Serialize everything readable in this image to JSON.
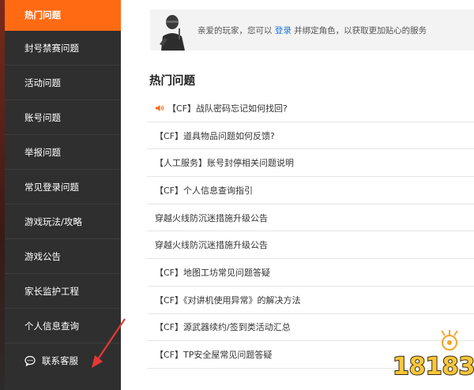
{
  "sidebar": {
    "items": [
      {
        "label": "热门问题",
        "active": true
      },
      {
        "label": "封号禁赛问题"
      },
      {
        "label": "活动问题"
      },
      {
        "label": "账号问题"
      },
      {
        "label": "举报问题"
      },
      {
        "label": "常见登录问题"
      },
      {
        "label": "游戏玩法/攻略"
      },
      {
        "label": "游戏公告"
      },
      {
        "label": "家长监护工程"
      },
      {
        "label": "个人信息查询"
      }
    ],
    "contact": {
      "label": "联系客服",
      "icon": "chat-bubble-icon"
    }
  },
  "notice": {
    "prefix": "亲爱的玩家，您可以 ",
    "login_link": "登录",
    "suffix": " 并绑定角色，以获取更加贴心的服务"
  },
  "main": {
    "section_title": "热门问题",
    "questions": [
      {
        "text": "【CF】战队密码忘记如何找回?",
        "icon": "speaker-icon"
      },
      {
        "text": "【CF】道具物品问题如何反馈?"
      },
      {
        "text": "【人工服务】账号封停相关问题说明"
      },
      {
        "text": "【CF】个人信息查询指引"
      },
      {
        "text": "穿越火线防沉迷措施升级公告"
      },
      {
        "text": "穿越火线防沉迷措施升级公告"
      },
      {
        "text": "【CF】地图工坊常见问题答疑"
      },
      {
        "text": "【CF】《对讲机使用异常》的解决方法"
      },
      {
        "text": "【CF】源武器续约/签到类活动汇总"
      },
      {
        "text": "【CF】TP安全屋常见问题答疑"
      }
    ]
  },
  "watermark": {
    "text": "18183"
  },
  "colors": {
    "accent": "#ff6a13",
    "sidebar_bg": "#2f2f2f",
    "link": "#1f76d3",
    "annotation": "#e53935"
  }
}
